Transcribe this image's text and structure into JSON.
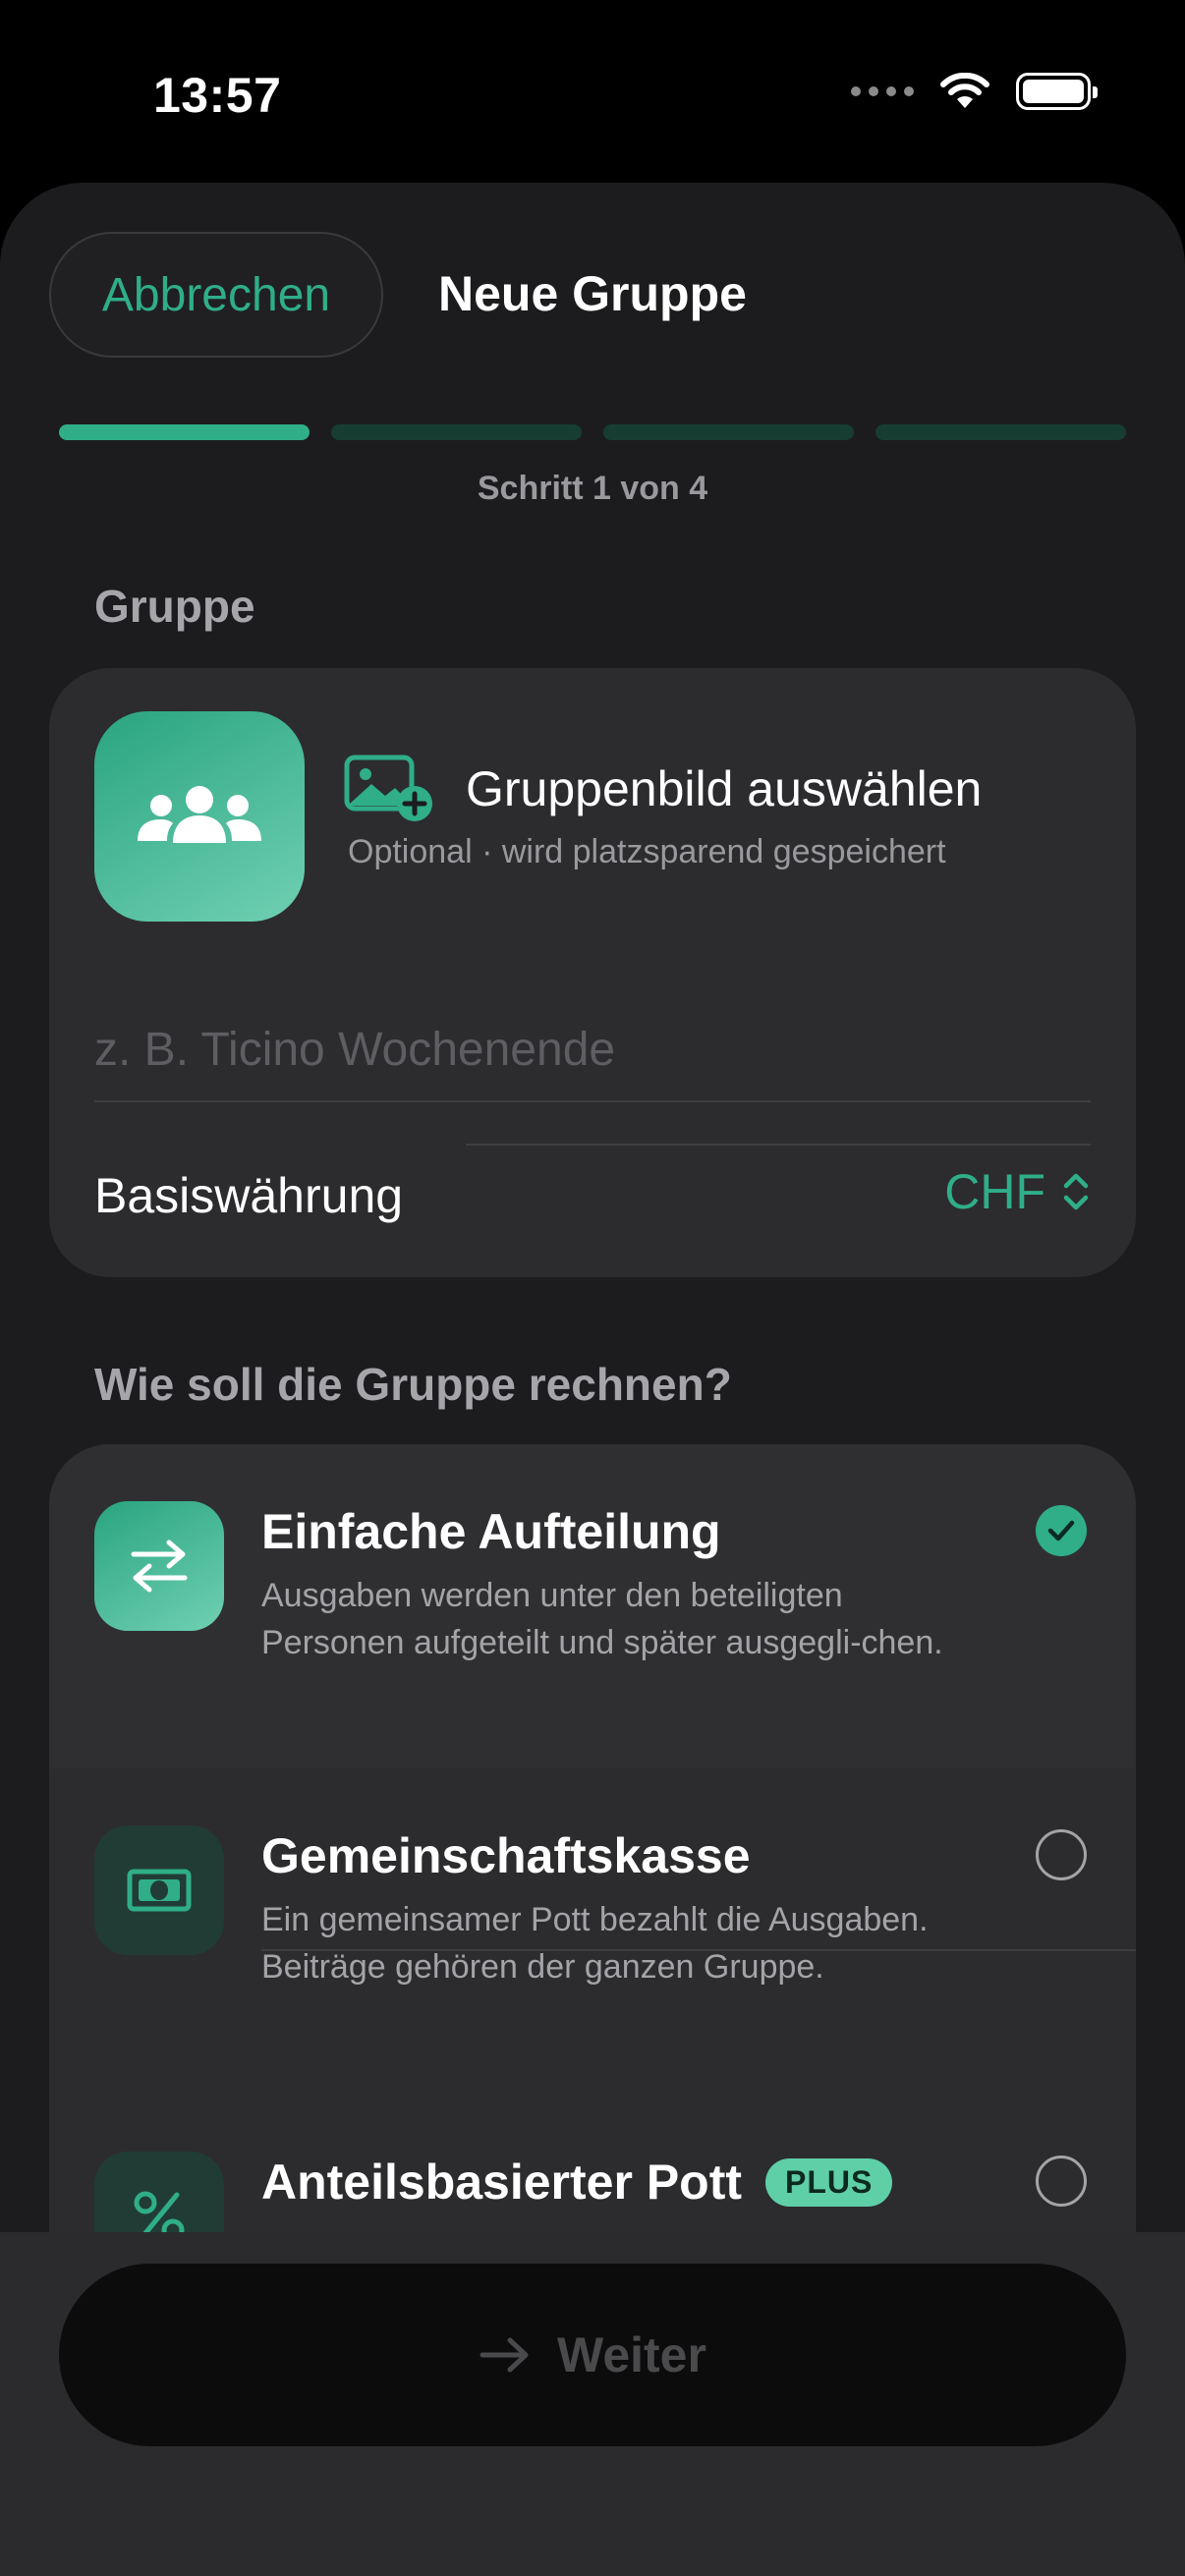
{
  "status_bar": {
    "time": "13:57"
  },
  "header": {
    "cancel_label": "Abbrechen",
    "title": "Neue Gruppe"
  },
  "progress": {
    "current_step": 1,
    "total_steps": 4,
    "label": "Schritt 1 von 4"
  },
  "group_section": {
    "heading": "Gruppe",
    "image_picker": {
      "title": "Gruppenbild auswählen",
      "subtitle": "Optional · wird platzsparend gespeichert"
    },
    "name_input": {
      "value": "",
      "placeholder": "z. B. Ticino Wochenende"
    },
    "currency": {
      "label": "Basiswährung",
      "value": "CHF"
    }
  },
  "mode_section": {
    "heading": "Wie soll die Gruppe rechnen?",
    "options": [
      {
        "title": "Einfache Aufteilung",
        "description": "Ausgaben werden unter den beteiligten Personen aufgeteilt und später ausgegli-chen.",
        "selected": true,
        "icon": "arrows-swap-icon"
      },
      {
        "title": "Gemeinschaftskasse",
        "description": "Ein gemeinsamer Pott bezahlt die Ausgaben. Beiträge gehören der ganzen Gruppe.",
        "selected": false,
        "icon": "banknote-icon"
      },
      {
        "title": "Anteilsbasierter Pott",
        "badge": "PLUS",
        "description": "",
        "selected": false,
        "icon": "percent-icon"
      }
    ]
  },
  "footer": {
    "next_label": "Weiter"
  },
  "colors": {
    "accent": "#2fae88",
    "background": "#1c1c1e",
    "card": "#2c2c2e"
  }
}
